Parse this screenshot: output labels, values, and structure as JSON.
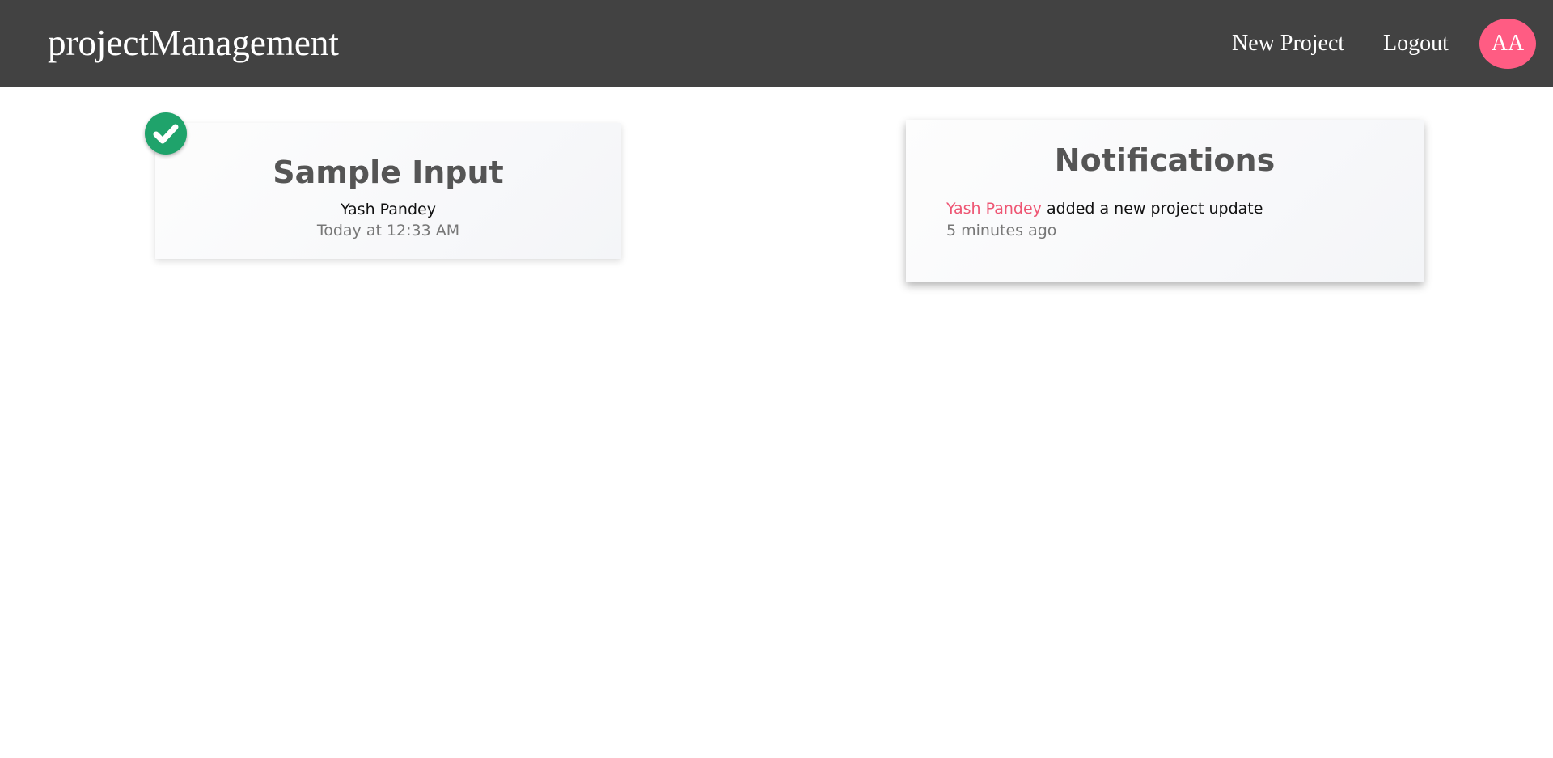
{
  "navbar": {
    "brand": "projectManagement",
    "links": [
      {
        "label": "New Project"
      },
      {
        "label": "Logout"
      }
    ],
    "avatar_initials": "AA",
    "background_color": "#424242",
    "avatar_color": "#ff5c83"
  },
  "projects": [
    {
      "title": "Sample Input",
      "author": "Yash Pandey",
      "date": "Today at 12:33 AM",
      "status_icon": "check-circle-icon",
      "status_color": "#1fa36b"
    }
  ],
  "notifications": {
    "title": "Notifications",
    "items": [
      {
        "user": "Yash Pandey",
        "text": " added a new project update",
        "time": "5 minutes ago"
      }
    ],
    "accent_color": "#ee5573"
  }
}
